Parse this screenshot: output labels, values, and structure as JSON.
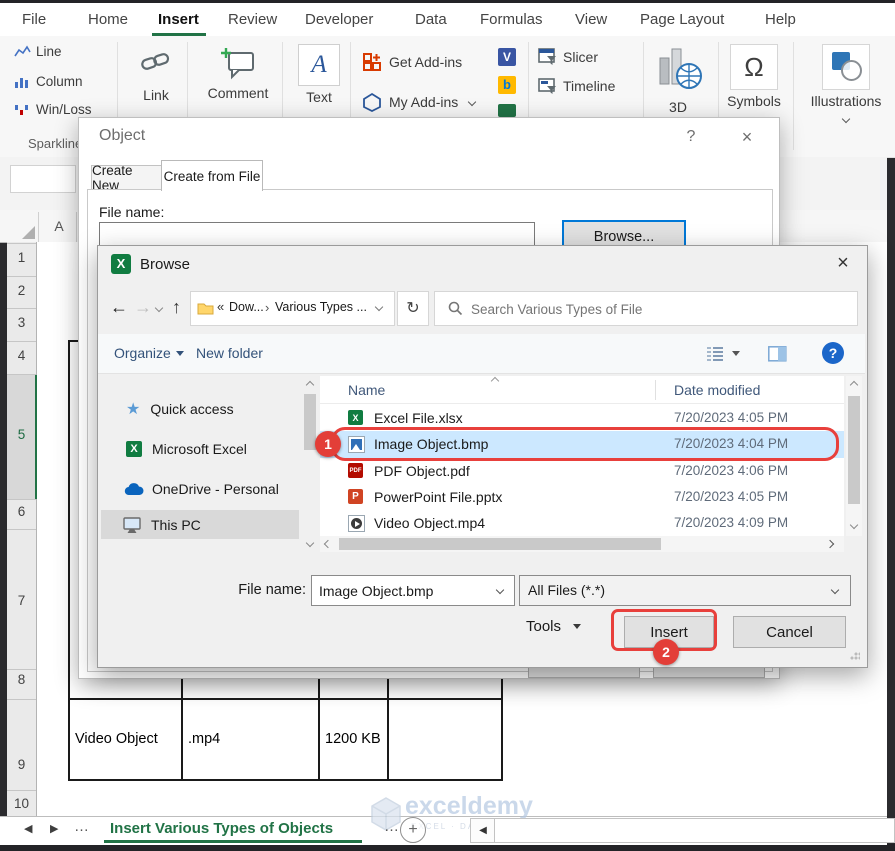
{
  "colors": {
    "excel_green": "#217346",
    "annotation_red": "#e8403c",
    "selection_blue": "#cce8ff",
    "focus_blue": "#0078d7"
  },
  "ribbon": {
    "tabs": [
      "File",
      "Home",
      "Insert",
      "Review",
      "Developer",
      "Data",
      "Formulas",
      "View",
      "Page Layout",
      "Help"
    ],
    "active_tab": "Insert",
    "sparkline_group": {
      "label": "Sparklines",
      "items": [
        "Line",
        "Column",
        "Win/Loss"
      ]
    },
    "link": "Link",
    "comment": "Comment",
    "text": "Text",
    "get_addins": "Get Add-ins",
    "my_addins": "My Add-ins",
    "slicer": "Slicer",
    "timeline": "Timeline",
    "maps_3d": "3D",
    "symbols": "Symbols",
    "illustrations": "Illustrations"
  },
  "object_dialog": {
    "title": "Object",
    "help": "?",
    "close": "×",
    "tab_create_new": "Create New",
    "tab_create_from_file": "Create from File",
    "file_name_label": "File name:",
    "browse": "Browse..."
  },
  "browse_dialog": {
    "title": "Browse",
    "close": "×",
    "address": {
      "chevrons": "«",
      "part1": "Dow...",
      "sep": "›",
      "part2": "Various Types ..."
    },
    "search_placeholder": "Search Various Types of File",
    "organize": "Organize",
    "new_folder": "New folder",
    "help": "?",
    "sidebar": [
      "Quick access",
      "Microsoft Excel",
      "OneDrive - Personal",
      "This PC"
    ],
    "col_name": "Name",
    "col_date": "Date modified",
    "files": [
      {
        "name": "Excel File.xlsx",
        "date": "7/20/2023 4:05 PM"
      },
      {
        "name": "Image Object.bmp",
        "date": "7/20/2023 4:04 PM"
      },
      {
        "name": "PDF Object.pdf",
        "date": "7/20/2023 4:06 PM"
      },
      {
        "name": "PowerPoint File.pptx",
        "date": "7/20/2023 4:05 PM"
      },
      {
        "name": "Video Object.mp4",
        "date": "7/20/2023 4:09 PM"
      }
    ],
    "file_name_label": "File name:",
    "file_name_value": "Image Object.bmp",
    "file_type": "All Files (*.*)",
    "tools": "Tools",
    "insert": "Insert",
    "cancel": "Cancel"
  },
  "annotations": {
    "step1": "1",
    "step2": "2"
  },
  "worksheet": {
    "col_a": "A",
    "rows": [
      "1",
      "2",
      "3",
      "4",
      "5",
      "6",
      "7",
      "8",
      "9",
      "10"
    ],
    "cells": {
      "name": "Video Object",
      "ext": ".mp4",
      "size": "1200 KB"
    },
    "sheet_tab": "Insert Various Types of Objects",
    "overflow_left": "…",
    "overflow_right": "…"
  },
  "watermark": {
    "brand": "exceldemy",
    "tagline": "EXCEL · DATA · BI"
  },
  "icons": {
    "back": "←",
    "forward": "→",
    "up": "↑",
    "refresh": "↻",
    "omega": "Ω",
    "star": "★",
    "nav_left": "◀",
    "nav_right": "▶",
    "scroll_left": "◀",
    "plus": "+",
    "excel_x": "X",
    "pdf": "PDF",
    "ppt": "P",
    "visio": "V",
    "bing": "b",
    "text_a": "A"
  }
}
